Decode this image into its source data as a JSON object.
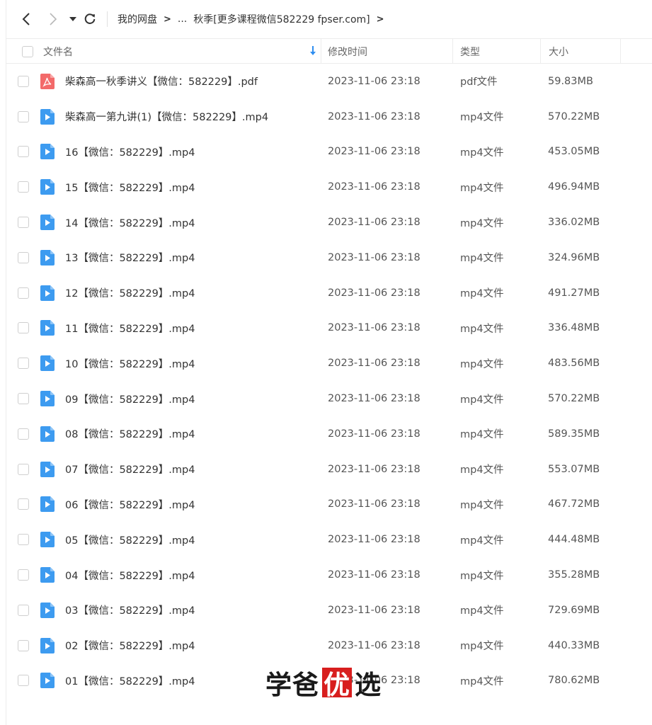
{
  "nav": {
    "breadcrumb": [
      {
        "label": "我的网盘"
      },
      {
        "label": "..."
      },
      {
        "label": "秋季[更多课程微信582229 fpser.com]"
      }
    ]
  },
  "table": {
    "headers": {
      "name": "文件名",
      "time": "修改时间",
      "type": "类型",
      "size": "大小"
    },
    "rows": [
      {
        "name": "柴森高一秋季讲义【微信：582229】.pdf",
        "time": "2023-11-06 23:18",
        "type": "pdf文件",
        "size": "59.83MB",
        "icon": "pdf-icon"
      },
      {
        "name": "柴森高一第九讲(1)【微信：582229】.mp4",
        "time": "2023-11-06 23:18",
        "type": "mp4文件",
        "size": "570.22MB",
        "icon": "video-icon"
      },
      {
        "name": "16【微信：582229】.mp4",
        "time": "2023-11-06 23:18",
        "type": "mp4文件",
        "size": "453.05MB",
        "icon": "video-icon"
      },
      {
        "name": "15【微信：582229】.mp4",
        "time": "2023-11-06 23:18",
        "type": "mp4文件",
        "size": "496.94MB",
        "icon": "video-icon"
      },
      {
        "name": "14【微信：582229】.mp4",
        "time": "2023-11-06 23:18",
        "type": "mp4文件",
        "size": "336.02MB",
        "icon": "video-icon"
      },
      {
        "name": "13【微信：582229】.mp4",
        "time": "2023-11-06 23:18",
        "type": "mp4文件",
        "size": "324.96MB",
        "icon": "video-icon"
      },
      {
        "name": "12【微信：582229】.mp4",
        "time": "2023-11-06 23:18",
        "type": "mp4文件",
        "size": "491.27MB",
        "icon": "video-icon"
      },
      {
        "name": "11【微信：582229】.mp4",
        "time": "2023-11-06 23:18",
        "type": "mp4文件",
        "size": "336.48MB",
        "icon": "video-icon"
      },
      {
        "name": "10【微信：582229】.mp4",
        "time": "2023-11-06 23:18",
        "type": "mp4文件",
        "size": "483.56MB",
        "icon": "video-icon"
      },
      {
        "name": "09【微信：582229】.mp4",
        "time": "2023-11-06 23:18",
        "type": "mp4文件",
        "size": "570.22MB",
        "icon": "video-icon"
      },
      {
        "name": "08【微信：582229】.mp4",
        "time": "2023-11-06 23:18",
        "type": "mp4文件",
        "size": "589.35MB",
        "icon": "video-icon"
      },
      {
        "name": "07【微信：582229】.mp4",
        "time": "2023-11-06 23:18",
        "type": "mp4文件",
        "size": "553.07MB",
        "icon": "video-icon"
      },
      {
        "name": "06【微信：582229】.mp4",
        "time": "2023-11-06 23:18",
        "type": "mp4文件",
        "size": "467.72MB",
        "icon": "video-icon"
      },
      {
        "name": "05【微信：582229】.mp4",
        "time": "2023-11-06 23:18",
        "type": "mp4文件",
        "size": "444.48MB",
        "icon": "video-icon"
      },
      {
        "name": "04【微信：582229】.mp4",
        "time": "2023-11-06 23:18",
        "type": "mp4文件",
        "size": "355.28MB",
        "icon": "video-icon"
      },
      {
        "name": "03【微信：582229】.mp4",
        "time": "2023-11-06 23:18",
        "type": "mp4文件",
        "size": "729.69MB",
        "icon": "video-icon"
      },
      {
        "name": "02【微信：582229】.mp4",
        "time": "2023-11-06 23:18",
        "type": "mp4文件",
        "size": "440.33MB",
        "icon": "video-icon"
      },
      {
        "name": "01【微信：582229】.mp4",
        "time": "2023-11-06 23:18",
        "type": "mp4文件",
        "size": "780.62MB",
        "icon": "video-icon"
      }
    ]
  },
  "watermark": {
    "part1": "学爸",
    "part2": "优",
    "part3": "选"
  },
  "colors": {
    "video_icon": "#3d9bf0",
    "pdf_icon": "#f36a6a",
    "sort_arrow": "#2f8ef0",
    "watermark_red": "#d81e1e"
  }
}
